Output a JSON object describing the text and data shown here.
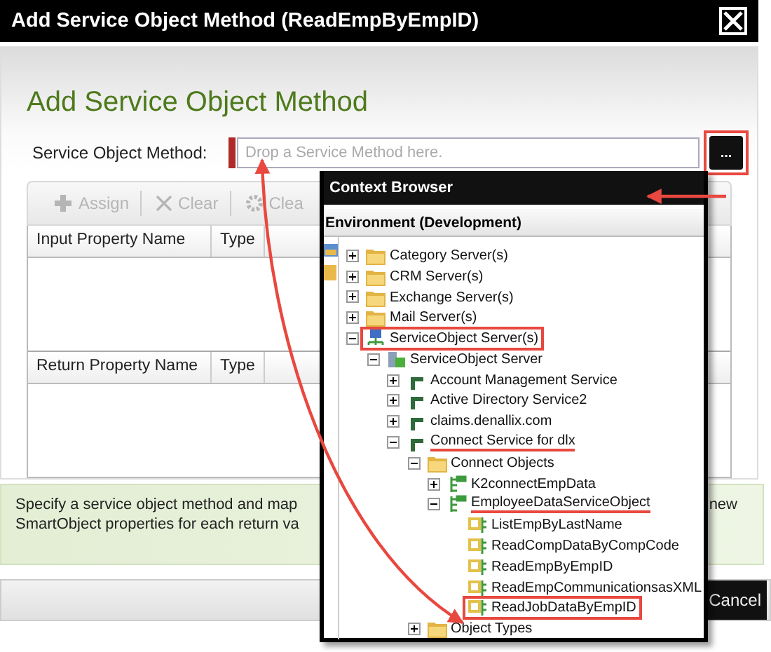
{
  "window": {
    "title": "Add Service Object Method (ReadEmpByEmpID)"
  },
  "heading": "Add Service Object Method",
  "method_field": {
    "label": "Service Object Method:",
    "placeholder": "Drop a Service Method here.",
    "browse_button": "...",
    "browse_highlighted": true
  },
  "toolbar": [
    {
      "label": "Assign",
      "kind": "add",
      "disabled": true
    },
    {
      "label": "Clear",
      "kind": "clear",
      "disabled": true
    },
    {
      "label": "Clea",
      "kind": "gear",
      "disabled": true
    }
  ],
  "input_table": {
    "columns": [
      "Input Property Name",
      "Type"
    ]
  },
  "return_table": {
    "columns": [
      "Return Property Name",
      "Type"
    ]
  },
  "info": {
    "lines": [
      "Specify a service object method and map",
      "SmartObject properties for each return va"
    ],
    "right_fragment": "new"
  },
  "footer": {
    "cancel": "Cancel"
  },
  "context_browser": {
    "title": "Context Browser",
    "environment": "Environment (Development)",
    "tree": [
      {
        "label": "Category Server(s)",
        "kind": "folder",
        "expanded": false,
        "boxed": false,
        "underlined": false
      },
      {
        "label": "CRM Server(s)",
        "kind": "folder",
        "expanded": false,
        "boxed": false,
        "underlined": false
      },
      {
        "label": "Exchange Server(s)",
        "kind": "folder",
        "expanded": false,
        "boxed": false,
        "underlined": false
      },
      {
        "label": "Mail Server(s)",
        "kind": "folder",
        "expanded": false,
        "boxed": false,
        "underlined": false
      },
      {
        "label": "ServiceObject Server(s)",
        "kind": "network",
        "expanded": true,
        "boxed": true,
        "underlined": false,
        "children": [
          {
            "label": "ServiceObject Server",
            "kind": "server",
            "expanded": true,
            "boxed": false,
            "underlined": false,
            "children": [
              {
                "label": "Account Management Service",
                "kind": "service",
                "expanded": false,
                "boxed": false,
                "underlined": false
              },
              {
                "label": "Active Directory Service2",
                "kind": "service",
                "expanded": false,
                "boxed": false,
                "underlined": false
              },
              {
                "label": "claims.denallix.com",
                "kind": "service",
                "expanded": false,
                "boxed": false,
                "underlined": false
              },
              {
                "label": "Connect Service for dlx",
                "kind": "service",
                "expanded": true,
                "boxed": false,
                "underlined": true,
                "children": [
                  {
                    "label": "Connect Objects",
                    "kind": "folder",
                    "expanded": true,
                    "boxed": false,
                    "underlined": false,
                    "children": [
                      {
                        "label": "K2connectEmpData",
                        "kind": "object",
                        "expanded": false,
                        "boxed": false,
                        "underlined": false
                      },
                      {
                        "label": "EmployeeDataServiceObject",
                        "kind": "object",
                        "expanded": true,
                        "boxed": false,
                        "underlined": true,
                        "children": [
                          {
                            "label": "ListEmpByLastName",
                            "kind": "method",
                            "boxed": false,
                            "underlined": false
                          },
                          {
                            "label": "ReadCompDataByCompCode",
                            "kind": "method",
                            "boxed": false,
                            "underlined": false
                          },
                          {
                            "label": "ReadEmpByEmpID",
                            "kind": "method",
                            "boxed": false,
                            "underlined": false
                          },
                          {
                            "label": "ReadEmpCommunicationsasXML",
                            "kind": "method",
                            "boxed": false,
                            "underlined": false
                          },
                          {
                            "label": "ReadJobDataByEmpID",
                            "kind": "method",
                            "boxed": true,
                            "underlined": false
                          }
                        ]
                      }
                    ]
                  },
                  {
                    "label": "Object Types",
                    "kind": "folder",
                    "expanded": false,
                    "boxed": false,
                    "underlined": false
                  }
                ]
              }
            ]
          }
        ]
      }
    ]
  }
}
